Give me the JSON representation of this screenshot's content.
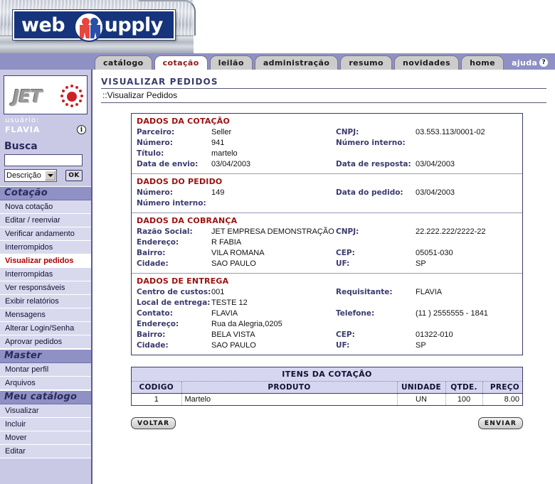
{
  "brand": {
    "word1": "web",
    "word2": "supply",
    "emblem_icon": "two-people-emblem-icon"
  },
  "tabs": [
    {
      "label": "catálogo",
      "active": false,
      "style": "normal"
    },
    {
      "label": "cotação",
      "active": true,
      "style": "normal"
    },
    {
      "label": "leilão",
      "active": false,
      "style": "normal"
    },
    {
      "label": "administração",
      "active": false,
      "style": "normal"
    },
    {
      "label": "resumo",
      "active": false,
      "style": "normal"
    },
    {
      "label": "novidades",
      "active": false,
      "style": "normal"
    },
    {
      "label": "home",
      "active": false,
      "style": "normal"
    },
    {
      "label": "ajuda",
      "active": false,
      "style": "help",
      "badge": "?"
    }
  ],
  "sidebar": {
    "logo_text": "JET",
    "user_label": "usuário:",
    "user_name": "FLAVIA",
    "info_icon": "info-icon",
    "search": {
      "title": "Busca",
      "input_value": "",
      "input_placeholder": "",
      "select_value": "Descrição",
      "select_options": [
        "Descrição"
      ],
      "ok_label": "OK"
    },
    "groups": [
      {
        "header": "Cotação",
        "items": [
          {
            "label": "Nova cotação",
            "current": false
          },
          {
            "label": "Editar / reenviar",
            "current": false
          },
          {
            "label": "Verificar andamento",
            "current": false
          },
          {
            "label": "Interrompidos",
            "current": false
          },
          {
            "label": "Visualizar pedidos",
            "current": true
          },
          {
            "label": "Interrompidas",
            "current": false
          },
          {
            "label": "Ver responsáveis",
            "current": false
          },
          {
            "label": "Exibir relatórios",
            "current": false
          },
          {
            "label": "Mensagens",
            "current": false
          },
          {
            "label": "Alterar Login/Senha",
            "current": false
          },
          {
            "label": "Aprovar pedidos",
            "current": false
          }
        ]
      },
      {
        "header": "Master",
        "items": [
          {
            "label": "Montar perfil",
            "current": false
          },
          {
            "label": "Arquivos",
            "current": false
          }
        ]
      },
      {
        "header": "Meu catálogo",
        "items": [
          {
            "label": "Visualizar",
            "current": false
          },
          {
            "label": "Incluir",
            "current": false
          },
          {
            "label": "Mover",
            "current": false
          },
          {
            "label": "Editar",
            "current": false
          }
        ]
      }
    ]
  },
  "main": {
    "page_title": "VISUALIZAR PEDIDOS",
    "breadcrumb": "::Visualizar Pedidos",
    "sections": [
      {
        "title": "DADOS DA COTAÇÃO",
        "rows": [
          {
            "label_left": "Parceiro:",
            "value_left": "Seller",
            "label_right": "CNPJ:",
            "value_right": "03.553.113/0001-02"
          },
          {
            "label_left": "Número:",
            "value_left": "941",
            "label_right": "Número interno:",
            "value_right": ""
          },
          {
            "label_left": "Título:",
            "value_left": "martelo",
            "label_right": "",
            "value_right": ""
          },
          {
            "label_left": "Data de envio:",
            "value_left": "03/04/2003",
            "label_right": "Data de resposta:",
            "value_right": "03/04/2003"
          }
        ]
      },
      {
        "title": "DADOS DO PEDIDO",
        "rows": [
          {
            "label_left": "Número:",
            "value_left": "149",
            "label_right": "Data do pedido:",
            "value_right": "03/04/2003"
          },
          {
            "label_left": "Número interno:",
            "value_left": "",
            "label_right": "",
            "value_right": ""
          }
        ]
      },
      {
        "title": "DADOS DA COBRANÇA",
        "rows": [
          {
            "label_left": "Razão Social:",
            "value_left": "JET EMPRESA DEMONSTRAÇÃO",
            "label_right": "CNPJ:",
            "value_right": "22.222.222/2222-22"
          },
          {
            "label_left": "Endereço:",
            "value_left": "R FABIA",
            "label_right": "",
            "value_right": ""
          },
          {
            "label_left": "Bairro:",
            "value_left": "VILA ROMANA",
            "label_right": "CEP:",
            "value_right": "05051-030"
          },
          {
            "label_left": "Cidade:",
            "value_left": "SAO PAULO",
            "label_right": "UF:",
            "value_right": "SP"
          }
        ]
      },
      {
        "title": "DADOS DE ENTREGA",
        "rows": [
          {
            "label_left": "Centro de custos:",
            "value_left": "001",
            "label_right": "Requisitante:",
            "value_right": "FLAVIA"
          },
          {
            "label_left": "Local de entrega:",
            "value_left": "TESTE 12",
            "label_right": "",
            "value_right": ""
          },
          {
            "label_left": "Contato:",
            "value_left": "FLAVIA",
            "label_right": "Telefone:",
            "value_right": "(11 ) 2555555 - 1841"
          },
          {
            "label_left": "Endereço:",
            "value_left": "Rua da Alegria,0205",
            "label_right": "",
            "value_right": ""
          },
          {
            "label_left": "Bairro:",
            "value_left": "BELA VISTA",
            "label_right": "CEP:",
            "value_right": "01322-010"
          },
          {
            "label_left": "Cidade:",
            "value_left": "SAO PAULO",
            "label_right": "UF:",
            "value_right": "SP"
          }
        ]
      }
    ],
    "items_table": {
      "caption": "ITENS DA COTAÇÃO",
      "columns": [
        "CODIGO",
        "PRODUTO",
        "UNIDADE",
        "QTDE.",
        "PREÇO"
      ],
      "rows": [
        {
          "codigo": "1",
          "produto": "Martelo",
          "unidade": "UN",
          "qtde": "100",
          "preco": "8.00"
        }
      ]
    },
    "actions": {
      "back_label": "VOLTAR",
      "send_label": "ENVIAR"
    }
  },
  "colors": {
    "brand_blue": "#16347c",
    "sidebar_bg": "#c9c9e6",
    "nav_header_bg": "#8f90c4",
    "accent_red": "#9b1111",
    "label_blue": "#3a3a6e",
    "current_item": "#b00000"
  }
}
